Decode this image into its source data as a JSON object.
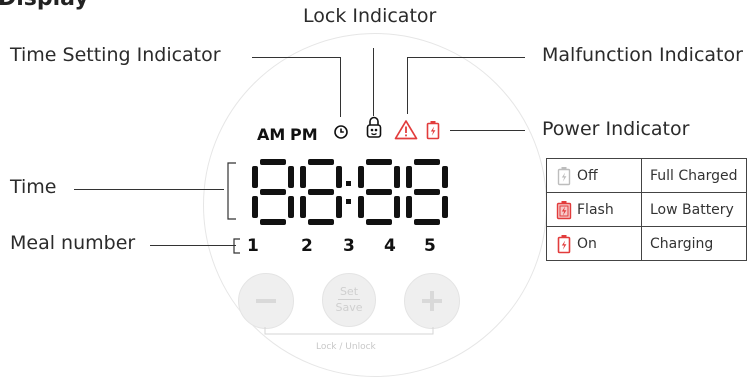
{
  "header": {
    "title": "Display"
  },
  "labels": {
    "lock": "Lock Indicator",
    "time_setting": "Time Setting Indicator",
    "malfunction": "Malfunction Indicator",
    "power": "Power Indicator",
    "time": "Time",
    "meal": "Meal number"
  },
  "display": {
    "am": "AM",
    "pm": "PM",
    "meal_numbers": [
      "1",
      "2",
      "3",
      "4",
      "5"
    ],
    "set_label": "Set",
    "save_label": "Save",
    "lock_unlock": "Lock / Unlock"
  },
  "power_table": {
    "rows": [
      {
        "icon": "battery-outline-icon",
        "state": "Off",
        "meaning": "Full Charged"
      },
      {
        "icon": "battery-flash-icon",
        "state": "Flash",
        "meaning": "Low Battery"
      },
      {
        "icon": "battery-on-icon",
        "state": "On",
        "meaning": "Charging"
      }
    ]
  },
  "colors": {
    "accent_red": "#e23c3c",
    "segment": "#111111",
    "panel_grey": "#e6e6e6"
  }
}
